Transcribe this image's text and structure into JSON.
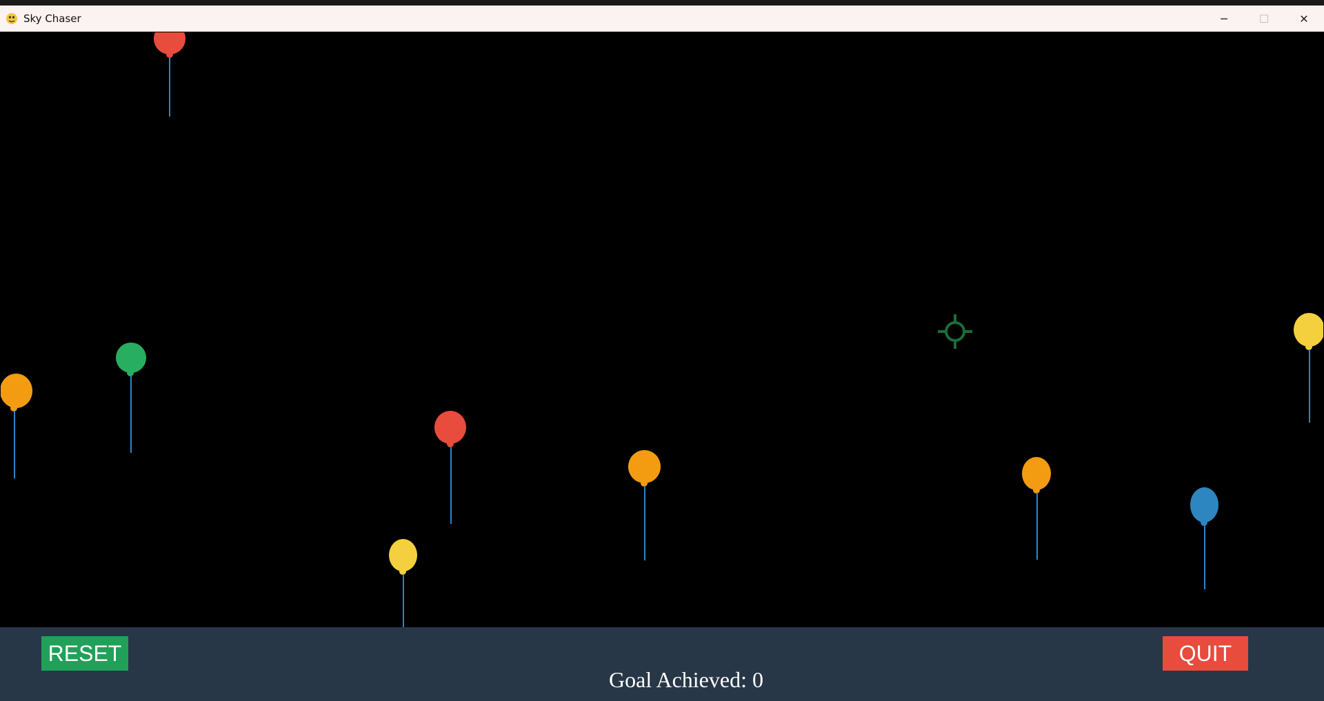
{
  "window": {
    "title": "Sky Chaser",
    "controls": {
      "minimize": "─",
      "maximize": "☐",
      "close": "✕"
    }
  },
  "icons": {
    "app": "pygame-snake-icon",
    "crosshair": "crosshair-icon"
  },
  "colors": {
    "red": "#e74c3c",
    "green": "#27ae60",
    "orange": "#f39c12",
    "yellow": "#f4d03f",
    "blue": "#2e86c1",
    "string": "#2f86c6",
    "crosshair": "#1e6b3a",
    "panel": "#283747"
  },
  "controls": {
    "reset_label": "RESET",
    "quit_label": "QUIT"
  },
  "status": {
    "score_text": "Goal Achieved: 0"
  }
}
